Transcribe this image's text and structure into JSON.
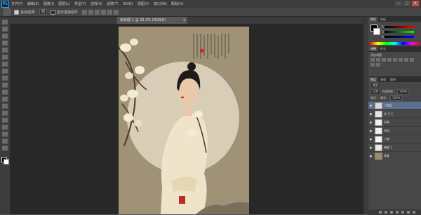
{
  "app": {
    "logo": "Ps"
  },
  "menu": [
    "文件(F)",
    "编辑(E)",
    "图像(I)",
    "图层(L)",
    "类型(Y)",
    "选择(S)",
    "滤镜(T)",
    "3D(D)",
    "视图(V)",
    "窗口(W)",
    "帮助(H)"
  ],
  "window_controls": {
    "minimize": "—",
    "maximize": "□",
    "close": "✕"
  },
  "options": {
    "auto_select_label": "自动选择：",
    "auto_select_target": "组",
    "transform_label": "显示变换控件"
  },
  "document_tab": {
    "label": "未标题-1 @ 33.3% (RGB/8)",
    "close": "×"
  },
  "panels": {
    "color_tabs": [
      "颜色",
      "色板"
    ],
    "sliders": [
      {
        "label": "R",
        "gradient": "linear-gradient(to right,#000,#f00)"
      },
      {
        "label": "G",
        "gradient": "linear-gradient(to right,#000,#0f0)"
      },
      {
        "label": "B",
        "gradient": "linear-gradient(to right,#000,#00f)"
      }
    ],
    "adjust_tabs": [
      "调整",
      "样式"
    ],
    "adjust_title": "添加调整"
  },
  "layers": {
    "tabs": [
      "图层",
      "通道",
      "路径"
    ],
    "kind_label": "类型",
    "blend_mode": "正常",
    "opacity_label": "不透明度：",
    "opacity": "100%",
    "lock_label": "锁定：",
    "fill_label": "填充：",
    "fill": "100%",
    "items": [
      {
        "name": "人物层",
        "active": true,
        "thumb": "#d8d8d8"
      },
      {
        "name": "花-玉兰",
        "active": false,
        "thumb": "#e4e4e4"
      },
      {
        "name": "印章",
        "active": false,
        "thumb": "#f0f0f0"
      },
      {
        "name": "诗词",
        "active": false,
        "thumb": "#efefef"
      },
      {
        "name": "人物",
        "active": false,
        "thumb": "#f6f6f6"
      },
      {
        "name": "椭圆 1",
        "active": false,
        "thumb": "#e8e8e8"
      },
      {
        "name": "背景",
        "active": false,
        "thumb": "#a08a64"
      }
    ]
  },
  "colors": {
    "canvas_bg": "#a09277",
    "moon": "#d9cdb7",
    "dress": "#efe3c9",
    "seal": "#c22a2a",
    "magnolia": "#f2ecd3"
  }
}
